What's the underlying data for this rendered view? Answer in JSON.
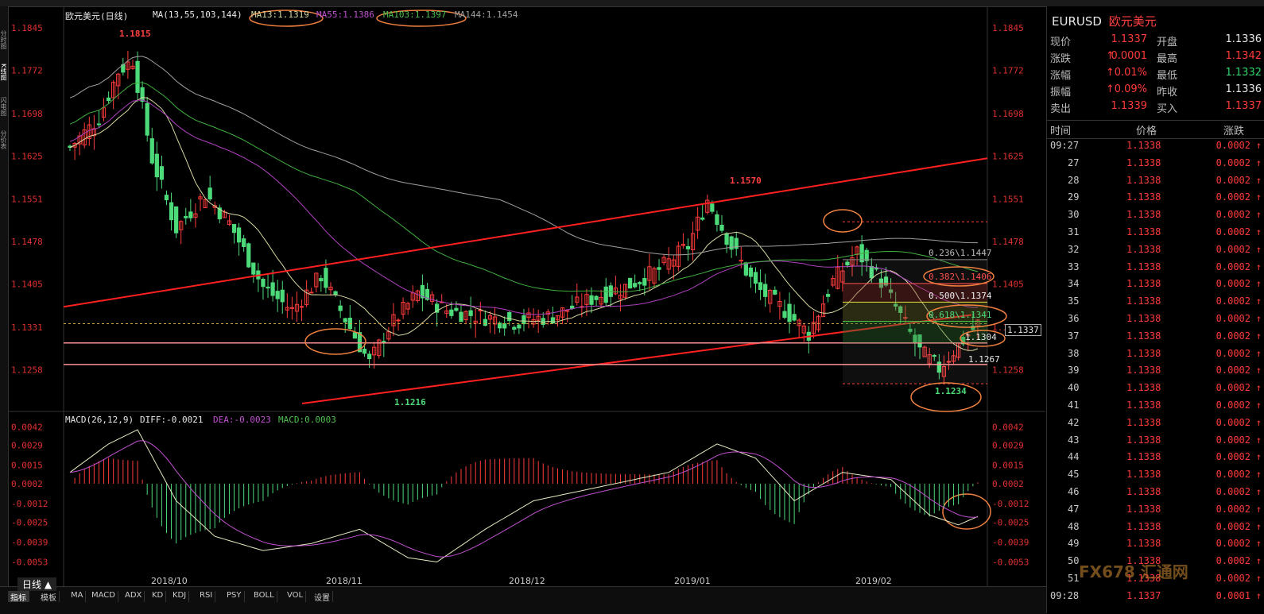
{
  "chart_header": {
    "title": "欧元美元(日线)",
    "ma_label": "MA(13,55,103,144)",
    "ma13": "MA13:1.1319",
    "ma55": "MA55:1.1386",
    "ma103": "MA103:1.1397",
    "ma144": "MA144:1.1454"
  },
  "macd_header": {
    "label": "MACD(26,12,9)",
    "diff": "DIFF:-0.0021",
    "dea": "DEA:-0.0023",
    "macd": "MACD:0.0003"
  },
  "colors": {
    "up": "#ff3b3b",
    "down": "#4ddb7a",
    "ma13": "#d8d8a0",
    "ma55": "#b040c0",
    "ma103": "#40b040",
    "ma144": "#a0a0a0",
    "trend": "#ff2020",
    "annotation": "#f08040"
  },
  "annotations": {
    "high": "1.1815",
    "low": "1.1216",
    "peak": "1.1570",
    "last_low": "1.1234",
    "fib_0236": "0.236\\1.1447",
    "fib_0382": "0.382\\1.1406",
    "fib_0500": "0.500\\1.1374",
    "fib_0618": "0.618\\1.1341",
    "level_1304": "1.1304",
    "level_1267": "1.1267",
    "current": "1.1337"
  },
  "chart_data": [
    {
      "type": "candlestick",
      "title": "欧元美元(日线)",
      "y_ticks": [
        "1.1845",
        "1.1772",
        "1.1698",
        "1.1625",
        "1.1551",
        "1.1478",
        "1.1405",
        "1.1331",
        "1.1258"
      ],
      "x_ticks": [
        "2018/10",
        "2018/11",
        "2018/12",
        "2019/01",
        "2019/02"
      ],
      "ylim": [
        1.12,
        1.186
      ],
      "series": [
        {
          "name": "MA13",
          "value": 1.1319
        },
        {
          "name": "MA55",
          "value": 1.1386
        },
        {
          "name": "MA103",
          "value": 1.1397
        },
        {
          "name": "MA144",
          "value": 1.1454
        }
      ],
      "key_levels": [
        1.1304,
        1.1267
      ],
      "current_price": 1.1337
    },
    {
      "type": "bar",
      "title": "MACD(26,12,9)",
      "y_ticks": [
        "0.0042",
        "0.0029",
        "0.0015",
        "0.0002",
        "-0.0012",
        "-0.0025",
        "-0.0039",
        "-0.0053"
      ],
      "ylim": [
        -0.006,
        0.0045
      ],
      "series": [
        {
          "name": "DIFF",
          "value": -0.0021
        },
        {
          "name": "DEA",
          "value": -0.0023
        },
        {
          "name": "MACD",
          "value": 0.0003
        }
      ]
    }
  ],
  "quote": {
    "symbol": "EURUSD",
    "name": "欧元美元",
    "rows": [
      {
        "l1": "现价",
        "v1": "1.1337",
        "c1": "red",
        "l2": "开盘",
        "v2": "1.1336",
        "c2": "wht"
      },
      {
        "l1": "涨跌",
        "v1": "0.0001",
        "c1": "red",
        "arrow1": true,
        "l2": "最高",
        "v2": "1.1342",
        "c2": "red"
      },
      {
        "l1": "涨幅",
        "v1": "0.01%",
        "c1": "red",
        "arrow1": true,
        "l2": "最低",
        "v2": "1.1332",
        "c2": "grn"
      },
      {
        "l1": "振幅",
        "v1": "0.09%",
        "c1": "red",
        "arrow1": true,
        "l2": "昨收",
        "v2": "1.1336",
        "c2": "wht"
      },
      {
        "l1": "卖出",
        "v1": "1.1339",
        "c1": "red",
        "l2": "买入",
        "v2": "1.1337",
        "c2": "red"
      }
    ]
  },
  "ticks_header": {
    "time": "时间",
    "price": "价格",
    "change": "涨跌"
  },
  "ticks": [
    {
      "t": "09:27",
      "p": "1.1338",
      "c": "0.0002"
    },
    {
      "t": "27",
      "p": "1.1338",
      "c": "0.0002"
    },
    {
      "t": "28",
      "p": "1.1338",
      "c": "0.0002"
    },
    {
      "t": "29",
      "p": "1.1338",
      "c": "0.0002"
    },
    {
      "t": "30",
      "p": "1.1338",
      "c": "0.0002"
    },
    {
      "t": "31",
      "p": "1.1338",
      "c": "0.0002"
    },
    {
      "t": "32",
      "p": "1.1338",
      "c": "0.0002"
    },
    {
      "t": "33",
      "p": "1.1338",
      "c": "0.0002"
    },
    {
      "t": "34",
      "p": "1.1338",
      "c": "0.0002"
    },
    {
      "t": "35",
      "p": "1.1338",
      "c": "0.0002"
    },
    {
      "t": "36",
      "p": "1.1338",
      "c": "0.0002"
    },
    {
      "t": "37",
      "p": "1.1338",
      "c": "0.0002"
    },
    {
      "t": "38",
      "p": "1.1338",
      "c": "0.0002"
    },
    {
      "t": "39",
      "p": "1.1338",
      "c": "0.0002"
    },
    {
      "t": "40",
      "p": "1.1338",
      "c": "0.0002"
    },
    {
      "t": "41",
      "p": "1.1338",
      "c": "0.0002"
    },
    {
      "t": "42",
      "p": "1.1338",
      "c": "0.0002"
    },
    {
      "t": "43",
      "p": "1.1338",
      "c": "0.0002"
    },
    {
      "t": "44",
      "p": "1.1338",
      "c": "0.0002"
    },
    {
      "t": "45",
      "p": "1.1338",
      "c": "0.0002"
    },
    {
      "t": "46",
      "p": "1.1338",
      "c": "0.0002"
    },
    {
      "t": "47",
      "p": "1.1338",
      "c": "0.0002"
    },
    {
      "t": "48",
      "p": "1.1338",
      "c": "0.0002"
    },
    {
      "t": "49",
      "p": "1.1338",
      "c": "0.0002"
    },
    {
      "t": "50",
      "p": "1.1338",
      "c": "0.0002"
    },
    {
      "t": "51",
      "p": "1.1338",
      "c": "0.0002"
    },
    {
      "t": "09:28",
      "p": "1.1337",
      "c": "0.0001"
    }
  ],
  "bottom": {
    "period": "日线 ▲",
    "tabs": [
      "指标",
      "模板",
      "MA",
      "MACD",
      "ADX",
      "KD",
      "KDJ",
      "RSI",
      "PSY",
      "BOLL",
      "VOL",
      "设置"
    ]
  },
  "left_tabs": [
    "分时图",
    "K线图",
    "闪电图",
    "分价表"
  ],
  "watermark": "FX678 汇通网"
}
